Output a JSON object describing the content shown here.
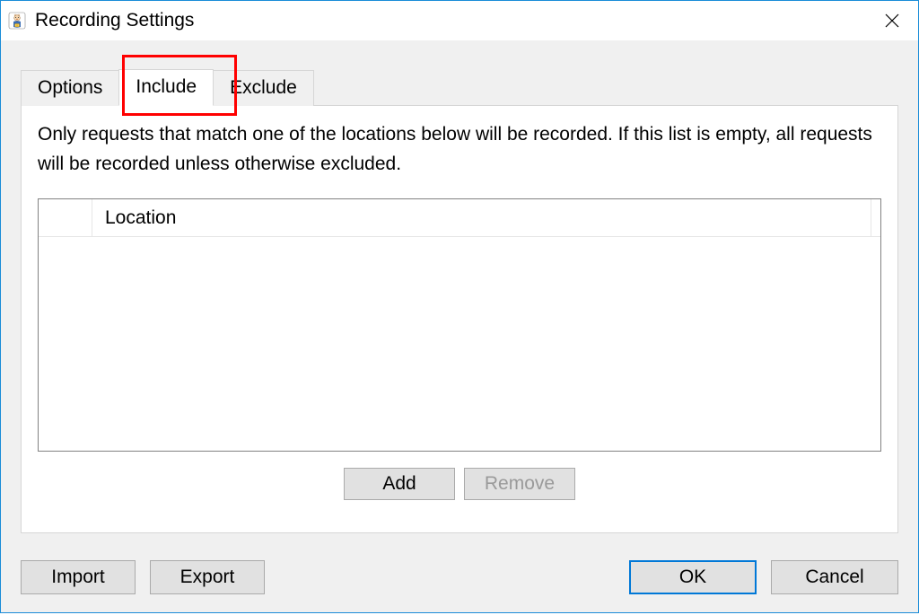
{
  "window": {
    "title": "Recording Settings"
  },
  "tabs": [
    {
      "label": "Options",
      "active": false
    },
    {
      "label": "Include",
      "active": true
    },
    {
      "label": "Exclude",
      "active": false
    }
  ],
  "description": "Only requests that match one of the locations below will be recorded. If this list is empty, all requests will be recorded unless otherwise excluded.",
  "list": {
    "columns": {
      "location": "Location"
    },
    "rows": []
  },
  "buttons": {
    "add": "Add",
    "remove": "Remove",
    "import": "Import",
    "export": "Export",
    "ok": "OK",
    "cancel": "Cancel"
  }
}
